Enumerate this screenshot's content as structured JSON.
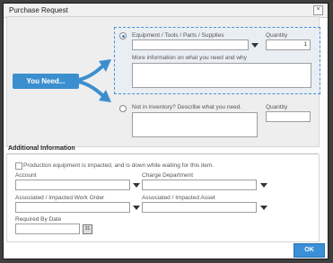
{
  "dialog": {
    "title": "Purchase Request",
    "close_glyph": "×"
  },
  "callout": {
    "label": "You Need..."
  },
  "option1": {
    "label": "Equipment / Tools / Parts / Supplies",
    "quantity_label": "Quantity",
    "quantity_value": "1",
    "info_label": "More information on what you need and why",
    "selected": true
  },
  "option2": {
    "label": "Not in inventory? Describe what you need.",
    "quantity_label": "Quantity",
    "selected": false
  },
  "additional": {
    "heading": "Additional Information",
    "checkbox_label": "Production equipment is impacted, and is down while waiting for this item.",
    "account_label": "Account",
    "charge_label": "Charge Department",
    "workorder_label": "Associated / Impacted Work Order",
    "asset_label": "Associated / Impacted Asset",
    "date_label": "Required By Date",
    "calendar_glyph": "31"
  },
  "footer": {
    "ok_label": "OK"
  },
  "colors": {
    "accent": "#3a8fd6",
    "selected_border": "#4a90d9"
  },
  "icons": [
    "close-icon",
    "chevron-down-icon",
    "calendar-icon",
    "arrow-icon"
  ]
}
